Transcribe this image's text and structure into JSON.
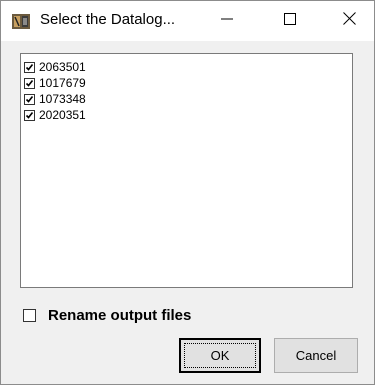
{
  "window": {
    "title": "Select the Datalog...",
    "icon": "app-icon",
    "controls": [
      "minimize-icon",
      "maximize-icon",
      "close-icon"
    ]
  },
  "list": {
    "items": [
      {
        "label": "2063501",
        "checked": true
      },
      {
        "label": "1017679",
        "checked": true
      },
      {
        "label": "1073348",
        "checked": true
      },
      {
        "label": "2020351",
        "checked": true
      }
    ]
  },
  "rename": {
    "label": "Rename output files",
    "checked": false
  },
  "buttons": {
    "ok_label": "OK",
    "cancel_label": "Cancel"
  }
}
